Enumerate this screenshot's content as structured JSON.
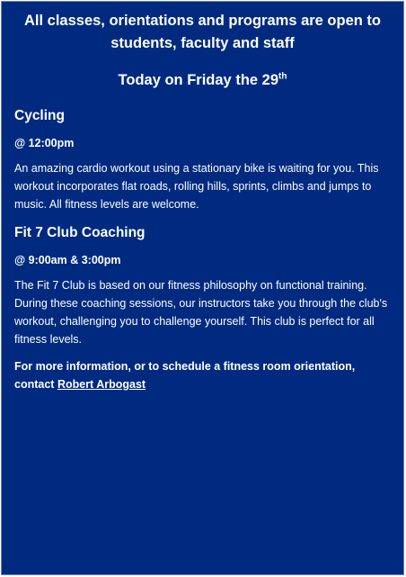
{
  "headline": "All classes, orientations and programs are open to students, faculty and staff",
  "today": {
    "text": "Today on Friday the 29",
    "suffix": "th"
  },
  "sections": [
    {
      "title": "Cycling",
      "time": "@ 12:00pm",
      "description": "An amazing cardio workout using a stationary bike is waiting for you. This workout incorporates flat roads, rolling hills, sprints, climbs and jumps to music. All fitness levels are welcome."
    },
    {
      "title": "Fit 7 Club Coaching",
      "time": "@ 9:00am & 3:00pm",
      "description": "The Fit 7 Club is based on our fitness philosophy on functional training. During these coaching sessions, our instructors take you through the club's workout, challenging you to challenge yourself. This club is perfect for all fitness levels."
    }
  ],
  "footer": {
    "text": "For more information, or to schedule a fitness room orientation, contact ",
    "contact_name": "Robert Arbogast"
  },
  "colors": {
    "background": "#002a7f",
    "text": "#ffffff"
  }
}
